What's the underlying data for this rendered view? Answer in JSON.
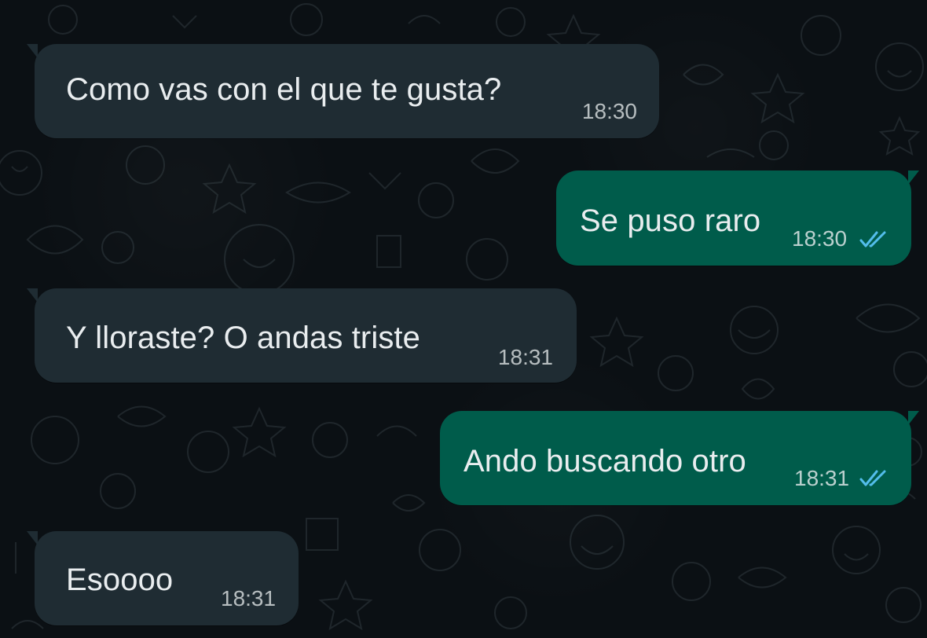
{
  "colors": {
    "incoming_bubble": "#1f2c33",
    "outgoing_bubble": "#005c4b",
    "read_ticks": "#53bdeb",
    "background": "#0b1014"
  },
  "messages": [
    {
      "direction": "incoming",
      "text": "Como vas con el que te gusta?",
      "time": "18:30"
    },
    {
      "direction": "outgoing",
      "text": "Se puso raro",
      "time": "18:30",
      "status_icon": "double-check-read-icon"
    },
    {
      "direction": "incoming",
      "text": "Y lloraste? O andas triste",
      "time": "18:31"
    },
    {
      "direction": "outgoing",
      "text": "Ando buscando otro",
      "time": "18:31",
      "status_icon": "double-check-read-icon"
    },
    {
      "direction": "incoming",
      "text": "Esoooo",
      "time": "18:31"
    }
  ]
}
